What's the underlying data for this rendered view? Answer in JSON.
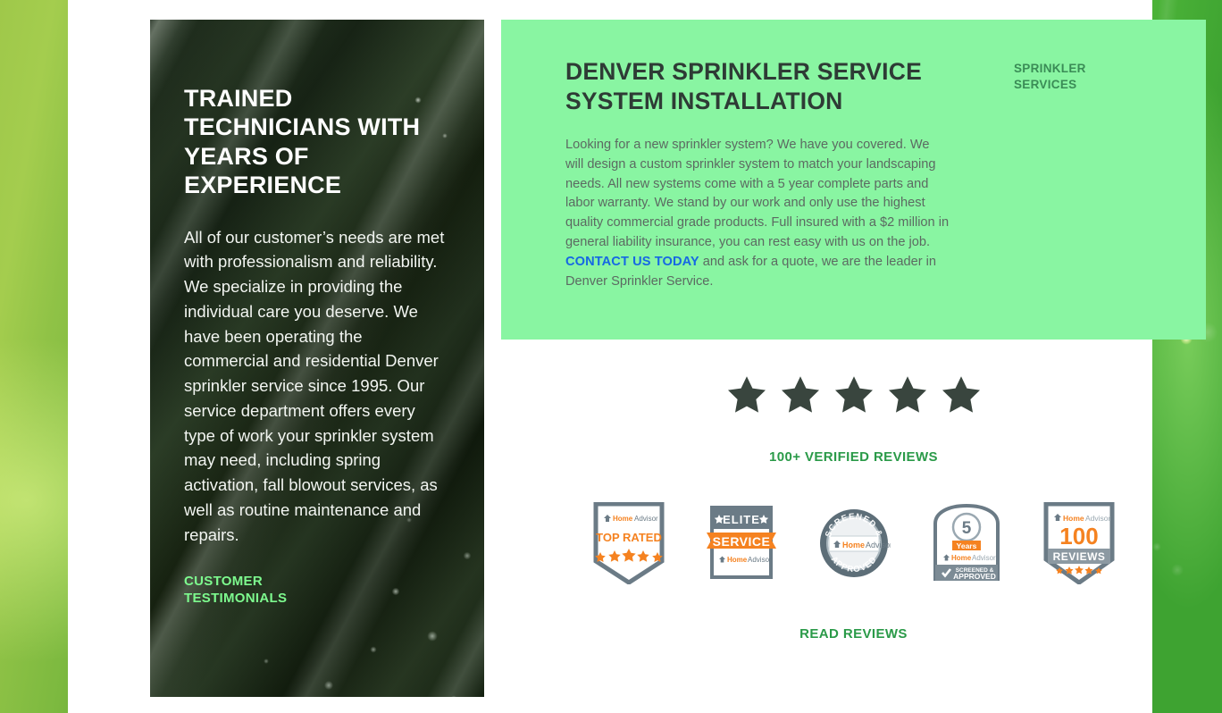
{
  "left_panel": {
    "heading": "Trained technicians with years of experience",
    "body": "All of our customer’s needs are met with professionalism and reliability. We specialize in providing the individual care you deserve. We have been operating the commercial and residential Denver sprinkler service since 1995. Our service department offers every type of work your sprinkler system may need, including spring activation, fall blowout services, as well as routine maintenance and repairs.",
    "link_label": "Customer Testimonials"
  },
  "green_panel": {
    "heading": "Denver Sprinkler Service System Installation",
    "body_part1": "Looking for a new sprinkler system? We have you covered. We will design a custom sprinkler system to match your landscaping needs. All new systems come with a 5 year complete parts and labor warranty. We stand by our work and only use the highest quality commercial grade products. Full insured with a $2 million in general liability insurance, you can rest easy with us on the job. ",
    "link_label": "CONTACT US TODAY",
    "body_part2": " and ask for a quote, we are the leader in Denver Sprinkler Service.",
    "side_label": "Sprinkler Services",
    "background_color": "#89f5a2",
    "link_color": "#1668e3"
  },
  "reviews": {
    "star_count": 5,
    "star_color": "#39453e",
    "verified_label": "100+ Verified Reviews",
    "read_reviews_label": "Read Reviews",
    "accent_color": "#2a9a48",
    "badges": [
      {
        "name": "homeadvisor-top-rated-badge",
        "brand": "HomeAdvisor",
        "title": "TOP RATED",
        "stars": 5
      },
      {
        "name": "homeadvisor-elite-service-badge",
        "brand": "HomeAdvisor",
        "title": "ELITE",
        "subtitle": "SERVICE"
      },
      {
        "name": "homeadvisor-screened-approved-seal",
        "brand": "HomeAdvisor",
        "title": "SCREENED &",
        "subtitle": "APPROVED"
      },
      {
        "name": "homeadvisor-5-years-badge",
        "brand": "HomeAdvisor",
        "number": "5",
        "title": "Years",
        "subtitle": "SCREENED & APPROVED"
      },
      {
        "name": "homeadvisor-100-reviews-badge",
        "brand": "HomeAdvisor",
        "number": "100",
        "title": "REVIEWS",
        "stars": 5
      }
    ]
  }
}
